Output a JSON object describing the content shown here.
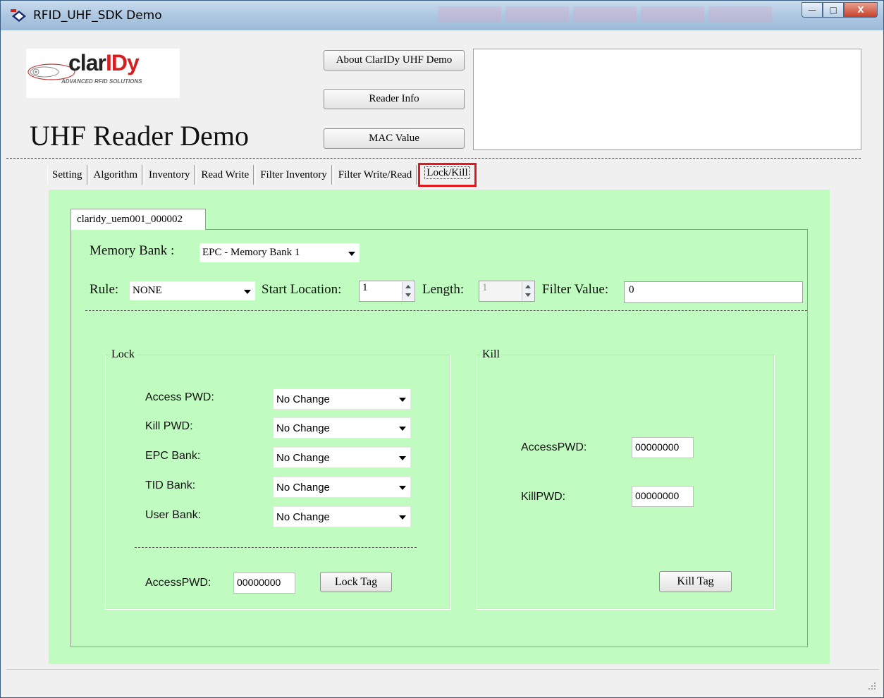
{
  "window": {
    "title": "RFID_UHF_SDK Demo",
    "controls": {
      "minimize": "—",
      "maximize": "□",
      "close": "X"
    }
  },
  "header": {
    "logo_brand_prefix": "clar",
    "logo_brand_accent": "IDy",
    "logo_tagline": "ADVANCED RFID SOLUTIONS",
    "app_title": "UHF Reader Demo",
    "buttons": {
      "about": "About ClarIDy UHF Demo",
      "reader_info": "Reader Info",
      "mac_value": "MAC Value"
    },
    "info_box_text": ""
  },
  "tabs": [
    {
      "label": "Setting"
    },
    {
      "label": "Algorithm"
    },
    {
      "label": "Inventory"
    },
    {
      "label": "Read Write"
    },
    {
      "label": "Filter Inventory"
    },
    {
      "label": "Filter Write/Read"
    },
    {
      "label": "Lock/Kill",
      "active": true
    }
  ],
  "reader_tab": {
    "label": "claridy_uem001_000002"
  },
  "filter": {
    "memory_bank_label": "Memory Bank :",
    "memory_bank_value": "EPC - Memory Bank 1",
    "rule_label": "Rule:",
    "rule_value": "NONE",
    "start_location_label": "Start Location:",
    "start_location_value": "1",
    "length_label": "Length:",
    "length_value": "1",
    "filter_value_label": "Filter Value:",
    "filter_value_value": "0"
  },
  "lock": {
    "legend": "Lock",
    "rows": [
      {
        "label": "Access PWD:",
        "value": "No Change"
      },
      {
        "label": "Kill PWD:",
        "value": "No Change"
      },
      {
        "label": "EPC Bank:",
        "value": "No Change"
      },
      {
        "label": "TID Bank:",
        "value": "No Change"
      },
      {
        "label": "User Bank:",
        "value": "No Change"
      }
    ],
    "access_pwd_label": "AccessPWD:",
    "access_pwd_value": "00000000",
    "button": "Lock Tag"
  },
  "kill": {
    "legend": "Kill",
    "access_pwd_label": "AccessPWD:",
    "access_pwd_value": "00000000",
    "kill_pwd_label": "KillPWD:",
    "kill_pwd_value": "00000000",
    "button": "Kill Tag"
  },
  "colors": {
    "panel_green": "#c0fcc0",
    "highlight_red": "#e0191a",
    "logo_red": "#d42020"
  },
  "icons": {
    "app": "rfid-app-icon",
    "dropdown": "chevron-down-icon",
    "spin": "spinner-arrows-icon",
    "grip": "resize-grip-icon"
  }
}
